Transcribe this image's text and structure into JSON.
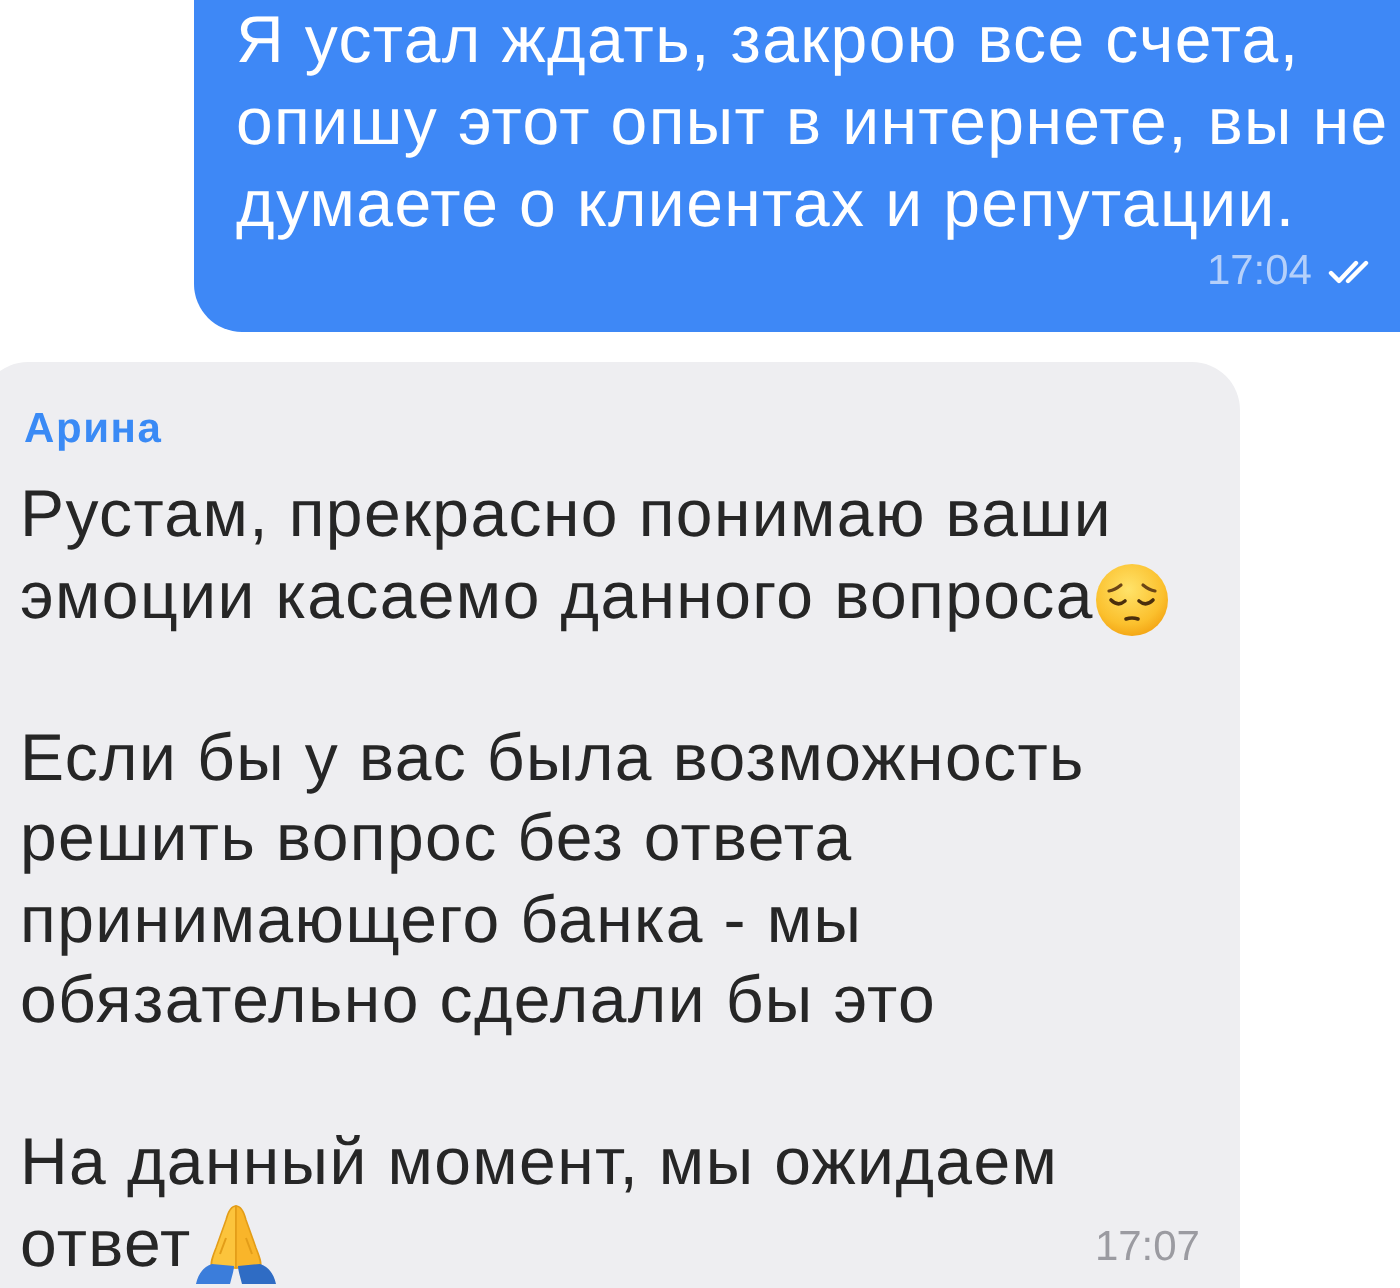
{
  "messages": [
    {
      "kind": "outgoing",
      "paragraphs": [
        {
          "lines": [
            "Я устал ждать, закрою все счета,",
            "опишу этот опыт в интернете, вы не",
            "думаете о клиентах и репутации."
          ]
        }
      ],
      "time": "17:04",
      "read": true
    },
    {
      "kind": "incoming",
      "sender": "Арина",
      "paragraphs": [
        {
          "lines": [
            "Рустам, прекрасно понимаю ваши",
            "эмоции касаемо данного вопроса"
          ],
          "emoji": {
            "kind": "pensive-face"
          }
        },
        {
          "lines": [
            "Если бы у вас была возможность",
            "решить вопрос без ответа",
            "принимающего банка - мы",
            "обязательно сделали бы это"
          ]
        },
        {
          "lines": [
            "На данный момент, мы ожидаем",
            "ответ"
          ],
          "emoji": {
            "kind": "folded-hands"
          }
        }
      ],
      "time": "17:07"
    }
  ]
}
